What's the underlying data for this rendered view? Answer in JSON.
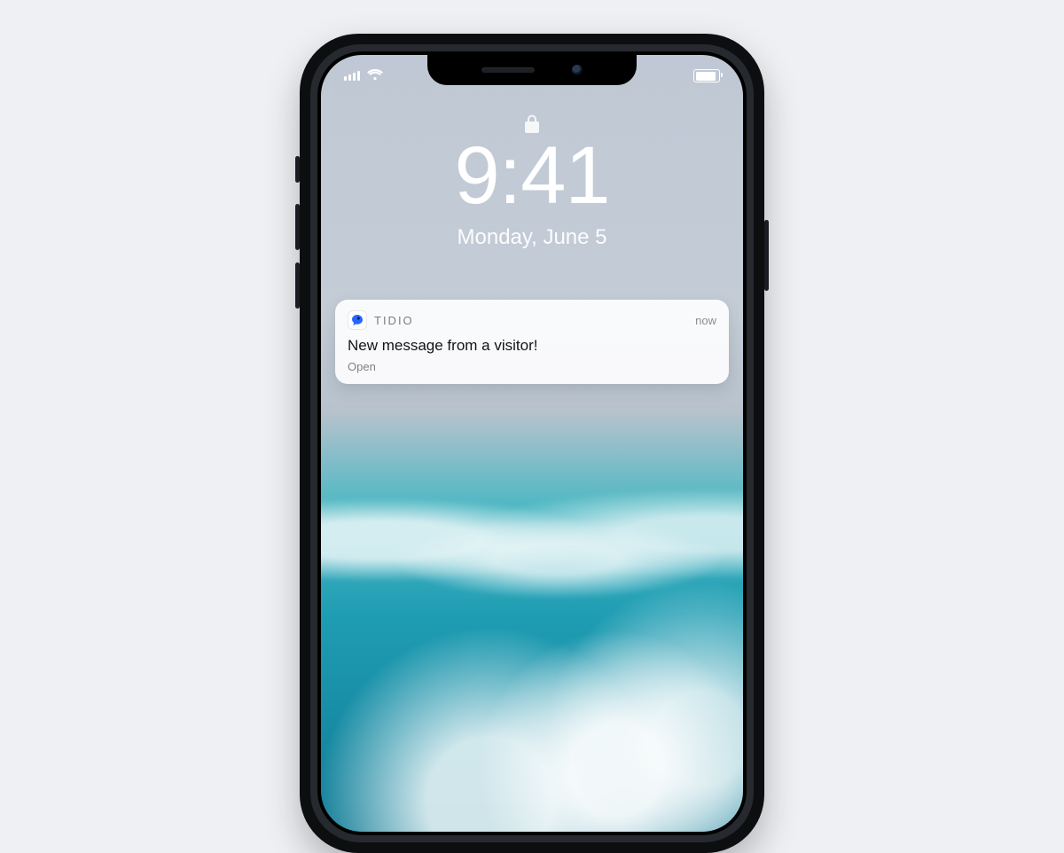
{
  "lockscreen": {
    "time": "9:41",
    "date": "Monday, June 5"
  },
  "notification": {
    "app_name": "TIDIO",
    "when": "now",
    "message": "New message from a visitor!",
    "action": "Open"
  }
}
